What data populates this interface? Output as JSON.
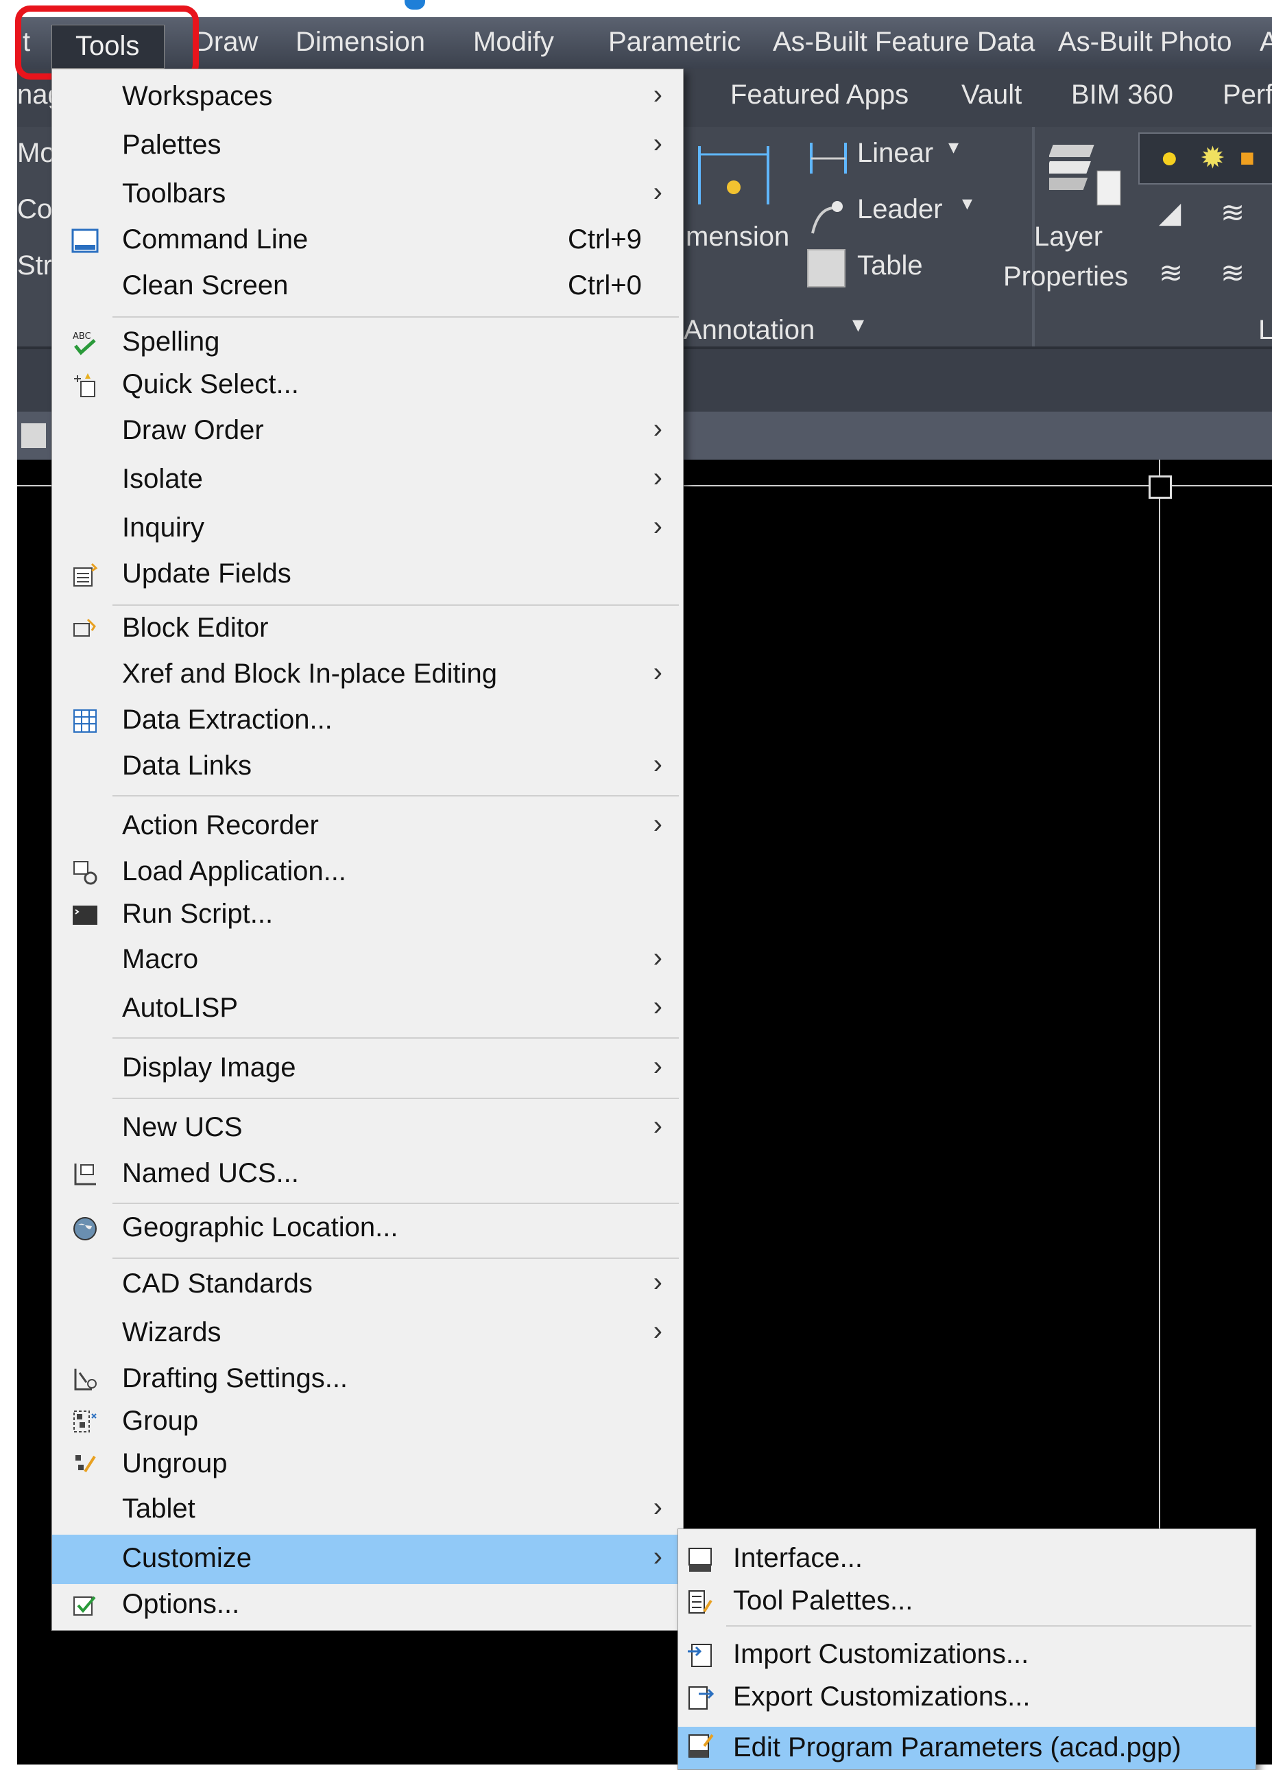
{
  "menubar": {
    "items": [
      "t",
      "Tools",
      "Draw",
      "Dimension",
      "Modify",
      "Parametric",
      "As-Built Feature Data",
      "As-Built Photo",
      "A"
    ]
  },
  "ribbon": {
    "tabs": [
      "Featured Apps",
      "Vault",
      "BIM 360",
      "Perf"
    ],
    "left_labels": [
      "nag",
      "Mo",
      "Co",
      "Str"
    ],
    "dimension_label": "mension",
    "linear": "Linear",
    "leader": "Leader",
    "table": "Table",
    "layer_properties_1": "Layer",
    "layer_properties_2": "Properties",
    "annotation": "Annotation",
    "right_l": "L"
  },
  "tools_menu": {
    "items": [
      {
        "label": "Workspaces",
        "submenu": true
      },
      {
        "label": "Palettes",
        "submenu": true
      },
      {
        "label": "Toolbars",
        "submenu": true
      },
      {
        "label": "Command Line",
        "shortcut": "Ctrl+9",
        "icon": "command-line-icon"
      },
      {
        "label": "Clean Screen",
        "shortcut": "Ctrl+0"
      },
      {
        "label": "Spelling",
        "icon": "spelling-icon"
      },
      {
        "label": "Quick Select...",
        "icon": "quick-select-icon"
      },
      {
        "label": "Draw Order",
        "submenu": true
      },
      {
        "label": "Isolate",
        "submenu": true
      },
      {
        "label": "Inquiry",
        "submenu": true
      },
      {
        "label": "Update Fields",
        "icon": "update-fields-icon"
      },
      {
        "label": "Block Editor",
        "icon": "block-editor-icon"
      },
      {
        "label": "Xref and Block In-place Editing",
        "submenu": true
      },
      {
        "label": "Data Extraction...",
        "icon": "data-extraction-icon"
      },
      {
        "label": "Data Links",
        "submenu": true
      },
      {
        "label": "Action Recorder",
        "submenu": true
      },
      {
        "label": "Load Application...",
        "icon": "load-application-icon"
      },
      {
        "label": "Run Script...",
        "icon": "run-script-icon"
      },
      {
        "label": "Macro",
        "submenu": true
      },
      {
        "label": "AutoLISP",
        "submenu": true
      },
      {
        "label": "Display Image",
        "submenu": true
      },
      {
        "label": "New UCS",
        "submenu": true
      },
      {
        "label": "Named UCS...",
        "icon": "named-ucs-icon"
      },
      {
        "label": "Geographic Location...",
        "icon": "globe-icon"
      },
      {
        "label": "CAD Standards",
        "submenu": true
      },
      {
        "label": "Wizards",
        "submenu": true
      },
      {
        "label": "Drafting Settings...",
        "icon": "drafting-settings-icon"
      },
      {
        "label": "Group",
        "icon": "group-icon"
      },
      {
        "label": "Ungroup",
        "icon": "ungroup-icon"
      },
      {
        "label": "Tablet",
        "submenu": true
      },
      {
        "label": "Customize",
        "submenu": true,
        "highlighted": true
      },
      {
        "label": "Options...",
        "icon": "options-icon"
      }
    ]
  },
  "customize_menu": {
    "items": [
      {
        "label": "Interface...",
        "icon": "interface-icon"
      },
      {
        "label": "Tool Palettes...",
        "icon": "tool-palettes-icon"
      },
      {
        "label": "Import Customizations...",
        "icon": "import-customizations-icon"
      },
      {
        "label": "Export Customizations...",
        "icon": "export-customizations-icon"
      },
      {
        "label": "Edit Program Parameters (acad.pgp)",
        "icon": "edit-pgp-icon",
        "highlighted": true
      }
    ]
  },
  "colors": {
    "highlight": "#91c9f7",
    "callout": "#e8141c",
    "menubar": "#4a505c"
  }
}
